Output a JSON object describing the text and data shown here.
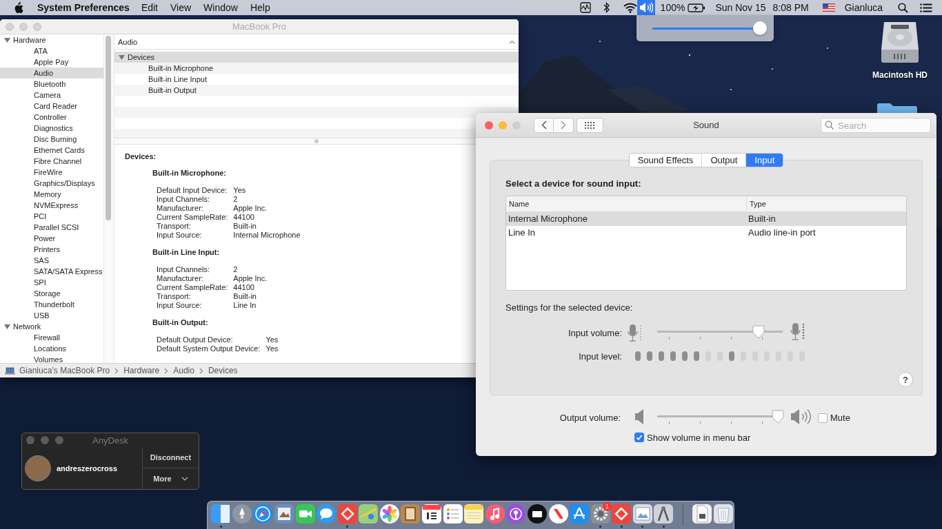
{
  "menu_bar": {
    "app_name": "System Preferences",
    "menus": [
      "Edit",
      "View",
      "Window",
      "Help"
    ],
    "battery": "100%",
    "date": "Sun Nov 15",
    "time": "8:08 PM",
    "user": "Gianluca"
  },
  "volume_popup": {
    "level": 1
  },
  "desktop": {
    "disk_label": "Macintosh HD"
  },
  "system_information": {
    "title": "MacBook Pro",
    "sidebar": [
      {
        "label": "Hardware",
        "expanded": true,
        "selected": false,
        "children": [
          {
            "label": "ATA",
            "selected": false
          },
          {
            "label": "Apple Pay",
            "selected": false
          },
          {
            "label": "Audio",
            "selected": true
          },
          {
            "label": "Bluetooth",
            "selected": false
          },
          {
            "label": "Camera",
            "selected": false
          },
          {
            "label": "Card Reader",
            "selected": false
          },
          {
            "label": "Controller",
            "selected": false
          },
          {
            "label": "Diagnostics",
            "selected": false
          },
          {
            "label": "Disc Burning",
            "selected": false
          },
          {
            "label": "Ethernet Cards",
            "selected": false
          },
          {
            "label": "Fibre Channel",
            "selected": false
          },
          {
            "label": "FireWire",
            "selected": false
          },
          {
            "label": "Graphics/Displays",
            "selected": false
          },
          {
            "label": "Memory",
            "selected": false
          },
          {
            "label": "NVMExpress",
            "selected": false
          },
          {
            "label": "PCI",
            "selected": false
          },
          {
            "label": "Parallel SCSI",
            "selected": false
          },
          {
            "label": "Power",
            "selected": false
          },
          {
            "label": "Printers",
            "selected": false
          },
          {
            "label": "SAS",
            "selected": false
          },
          {
            "label": "SATA/SATA Express",
            "selected": false
          },
          {
            "label": "SPI",
            "selected": false
          },
          {
            "label": "Storage",
            "selected": false
          },
          {
            "label": "Thunderbolt",
            "selected": false
          },
          {
            "label": "USB",
            "selected": false
          }
        ]
      },
      {
        "label": "Network",
        "expanded": true,
        "selected": false,
        "children": [
          {
            "label": "Firewall",
            "selected": false
          },
          {
            "label": "Locations",
            "selected": false
          },
          {
            "label": "Volumes",
            "selected": false
          }
        ]
      }
    ],
    "list_header": "Audio",
    "list": [
      {
        "label": "Devices",
        "expanded": true,
        "selected": true,
        "children": [
          {
            "label": "Built-in Microphone",
            "selected": false
          },
          {
            "label": "Built-in Line Input",
            "selected": false
          },
          {
            "label": "Built-in Output",
            "selected": false
          }
        ]
      }
    ],
    "detail": {
      "heading": "Devices:",
      "sections": [
        {
          "title": "Built-in Microphone:",
          "rows": [
            {
              "label": "Default Input Device:",
              "value": "Yes"
            },
            {
              "label": "Input Channels:",
              "value": "2"
            },
            {
              "label": "Manufacturer:",
              "value": "Apple Inc."
            },
            {
              "label": "Current SampleRate:",
              "value": "44100"
            },
            {
              "label": "Transport:",
              "value": "Built-in"
            },
            {
              "label": "Input Source:",
              "value": "Internal Microphone"
            }
          ]
        },
        {
          "title": "Built-in Line Input:",
          "rows": [
            {
              "label": "Input Channels:",
              "value": "2"
            },
            {
              "label": "Manufacturer:",
              "value": "Apple Inc."
            },
            {
              "label": "Current SampleRate:",
              "value": "44100"
            },
            {
              "label": "Transport:",
              "value": "Built-in"
            },
            {
              "label": "Input Source:",
              "value": "Line In"
            }
          ]
        },
        {
          "title": "Built-in Output:",
          "rows": [
            {
              "label": "Default Output Device:",
              "value": "Yes"
            },
            {
              "label": "Default System Output Device:",
              "value": "Yes"
            }
          ]
        }
      ]
    },
    "path": [
      "Gianluca’s MacBook Pro",
      "Hardware",
      "Audio",
      "Devices"
    ]
  },
  "sound": {
    "title": "Sound",
    "search_placeholder": "Search",
    "tabs": [
      {
        "label": "Sound Effects",
        "selected": false
      },
      {
        "label": "Output",
        "selected": false
      },
      {
        "label": "Input",
        "selected": true
      }
    ],
    "device_prompt": "Select a device for sound input:",
    "columns": [
      "Name",
      "Type"
    ],
    "devices": [
      {
        "name": "Internal Microphone",
        "type": "Built-in",
        "selected": true
      },
      {
        "name": "Line In",
        "type": "Audio line-in port",
        "selected": false
      }
    ],
    "settings_label": "Settings for the selected device:",
    "input_volume": {
      "label": "Input volume:",
      "level": 0.81
    },
    "input_level": {
      "label": "Input level:",
      "segments": [
        {
          "on": true
        },
        {
          "on": true
        },
        {
          "on": true
        },
        {
          "on": true
        },
        {
          "on": true
        },
        {
          "on": true
        },
        {
          "on": false
        },
        {
          "on": false
        },
        {
          "on": true
        },
        {
          "on": false
        },
        {
          "on": false
        },
        {
          "on": false
        },
        {
          "on": false
        },
        {
          "on": false
        },
        {
          "on": false
        }
      ]
    },
    "help": "?",
    "output_volume": {
      "label": "Output volume:",
      "level": 0.96
    },
    "mute": {
      "label": "Mute",
      "checked": false
    },
    "show_volume": {
      "label": "Show volume in menu bar",
      "checked": true
    }
  },
  "anydesk": {
    "title": "AnyDesk",
    "user": "andreszerocross",
    "buttons": [
      "Disconnect",
      "More"
    ]
  },
  "dock": [
    {
      "running": true
    },
    {
      "running": false
    },
    {
      "running": false
    },
    {
      "running": false
    },
    {
      "running": false
    },
    {
      "running": false
    },
    {
      "running": true
    },
    {
      "running": false
    },
    {
      "running": false
    },
    {
      "running": false
    },
    {
      "running": false
    },
    {
      "running": false
    },
    {
      "running": false
    },
    {
      "running": false
    },
    {
      "running": false
    },
    {
      "running": false
    },
    {
      "running": false
    },
    {
      "running": false
    },
    {
      "running": true,
      "badge": "1"
    },
    {
      "running": true
    },
    {
      "running": true
    },
    {
      "running": true
    },
    {
      "running": false
    },
    {
      "running": false
    }
  ]
}
